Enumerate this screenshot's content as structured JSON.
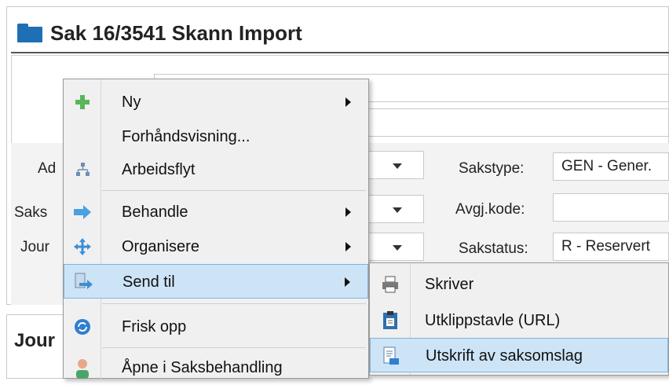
{
  "window": {
    "title": "Sak 16/3541 Skann Import",
    "bottom_section_title": "Jour"
  },
  "form": {
    "labels": {
      "ad": "Ad",
      "saks": "Saks",
      "jour": "Jour",
      "sakstype": "Sakstype:",
      "avgj_kode": "Avgj.kode:",
      "sakstatus": "Sakstatus:"
    },
    "values": {
      "sakstype": "GEN - Gener.",
      "avgj_kode": "",
      "sakstatus": "R - Reservert"
    }
  },
  "context_menu": {
    "items": [
      {
        "label": "Ny",
        "icon": "plus-icon",
        "has_submenu": true
      },
      {
        "label": "Forhåndsvisning...",
        "icon": "",
        "has_submenu": false
      },
      {
        "label": "Arbeidsflyt",
        "icon": "workflow-icon",
        "has_submenu": false
      },
      {
        "label": "Behandle",
        "icon": "arrow-right-icon",
        "has_submenu": true
      },
      {
        "label": "Organisere",
        "icon": "move-icon",
        "has_submenu": true
      },
      {
        "label": "Send til",
        "icon": "send-to-icon",
        "has_submenu": true,
        "highlighted": true
      },
      {
        "label": "Frisk opp",
        "icon": "refresh-icon",
        "has_submenu": false
      },
      {
        "label": "Åpne i Saksbehandling",
        "icon": "user-icon",
        "has_submenu": false
      }
    ]
  },
  "send_to_submenu": {
    "items": [
      {
        "label": "Skriver",
        "icon": "printer-icon"
      },
      {
        "label": "Utklippstavle (URL)",
        "icon": "clipboard-icon"
      },
      {
        "label": "Utskrift av saksomslag",
        "icon": "document-print-icon",
        "highlighted": true
      }
    ]
  },
  "colors": {
    "accent": "#1e6fb5",
    "highlight": "#cde4f7",
    "highlight_border": "#7fb3e0",
    "menu_bg": "#f0f0f0"
  }
}
